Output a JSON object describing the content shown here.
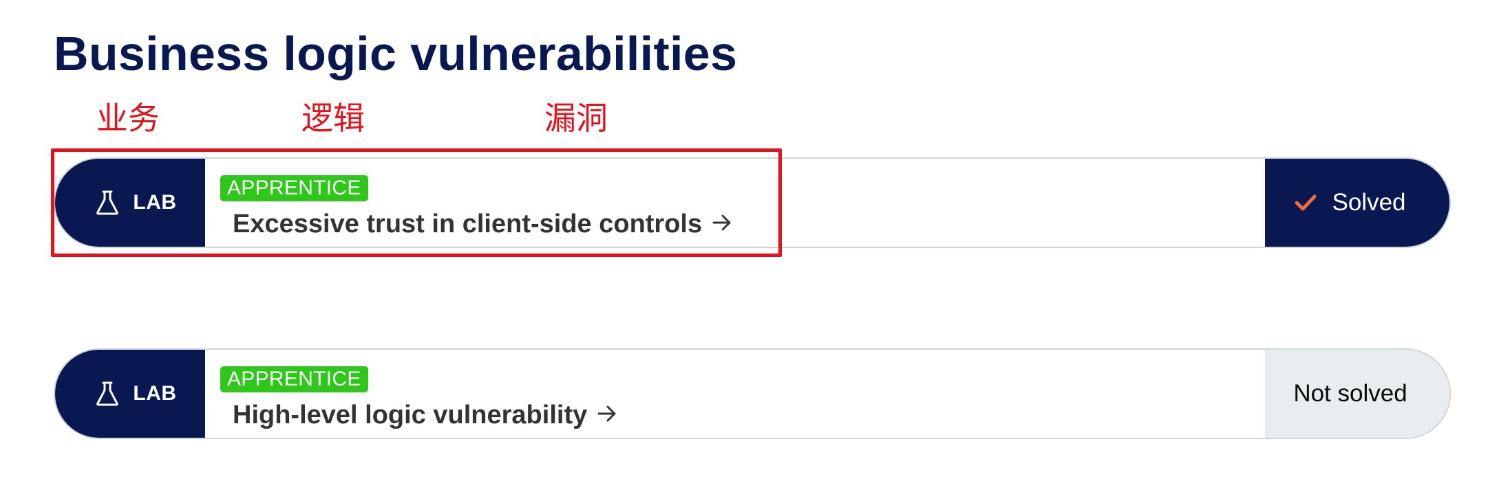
{
  "page": {
    "title": "Business logic vulnerabilities"
  },
  "annotations": {
    "word1": "业务",
    "word2": "逻辑",
    "word3": "漏洞",
    "color": "#e5121c"
  },
  "theme": {
    "navy": "#0a1852",
    "badge_green": "#2ec81a",
    "check_orange": "#f26a3d",
    "not_solved_bg": "#e8eef0"
  },
  "labs": [
    {
      "type_label": "LAB",
      "type_icon": "flask-icon",
      "level": "APPRENTICE",
      "title": "Excessive trust in client-side controls",
      "status": "Solved",
      "status_icon": "checkmark-icon",
      "highlighted": true
    },
    {
      "type_label": "LAB",
      "type_icon": "flask-icon",
      "level": "APPRENTICE",
      "title": "High-level logic vulnerability",
      "status": "Not solved",
      "highlighted": false
    }
  ]
}
